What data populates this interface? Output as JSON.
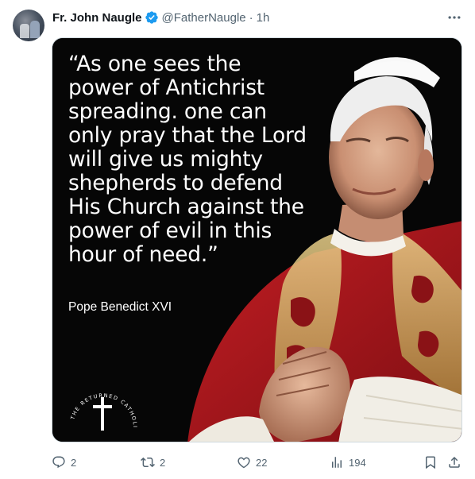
{
  "tweet": {
    "author_name": "Fr. John Naugle",
    "handle": "@FatherNaugle",
    "separator": "·",
    "time": "1h",
    "image": {
      "quote": "“As one sees the power of Antichrist spreading. one can only pray that the Lord will give us mighty shepherds to defend His Church against the power of evil in this hour of need.”",
      "attribution": "Pope Benedict XVI",
      "logo_text": "THE RETURNED CATHOLIC"
    },
    "actions": {
      "replies": "2",
      "reposts": "2",
      "likes": "22",
      "views": "194"
    }
  },
  "colors": {
    "verified": "#1d9bf0",
    "text_secondary": "#536471",
    "image_background": "#060606",
    "vestment_red": "#b3181c"
  }
}
